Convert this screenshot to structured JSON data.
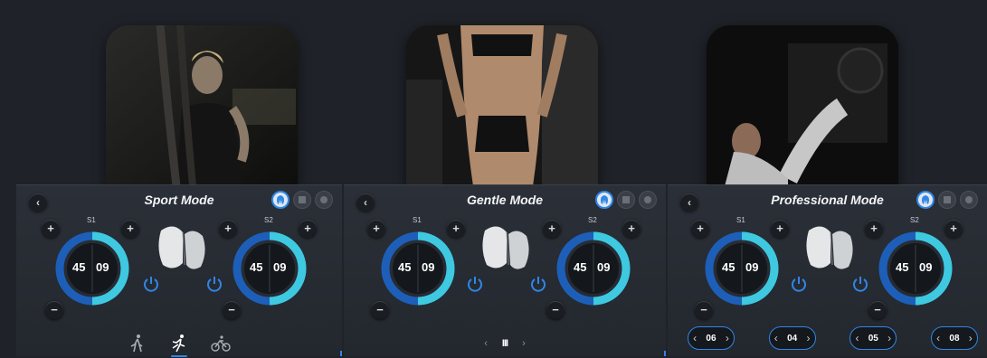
{
  "panels": [
    {
      "title": "Sport Mode",
      "back_icon": "chevron-left-icon",
      "channels": [
        {
          "label": "S1",
          "minutes": "45",
          "seconds": "09",
          "progress": 0.5
        },
        {
          "label": "S2",
          "minutes": "45",
          "seconds": "09",
          "progress": 0.5
        }
      ],
      "bottom": {
        "type": "activities",
        "items": [
          {
            "icon": "walk-icon",
            "active": false
          },
          {
            "icon": "run-icon",
            "active": true
          },
          {
            "icon": "bike-icon",
            "active": false
          }
        ]
      }
    },
    {
      "title": "Gentle Mode",
      "back_icon": "chevron-left-icon",
      "channels": [
        {
          "label": "S1",
          "minutes": "45",
          "seconds": "09",
          "progress": 0.5
        },
        {
          "label": "S2",
          "minutes": "45",
          "seconds": "09",
          "progress": 0.5
        }
      ],
      "bottom": {
        "type": "pager",
        "prev": "‹",
        "pause": "III",
        "next": "›"
      }
    },
    {
      "title": "Professional Mode",
      "back_icon": "chevron-left-icon",
      "channels": [
        {
          "label": "S1",
          "minutes": "45",
          "seconds": "09",
          "progress": 0.5
        },
        {
          "label": "S2",
          "minutes": "45",
          "seconds": "09",
          "progress": 0.5
        }
      ],
      "bottom": {
        "type": "steppers",
        "values": [
          "06",
          "04",
          "05",
          "08"
        ]
      }
    }
  ],
  "colors": {
    "accent": "#2f86e6",
    "ring_dark": "#1d5fb8",
    "ring_light": "#3ec9e0",
    "background": "#1f2329"
  }
}
